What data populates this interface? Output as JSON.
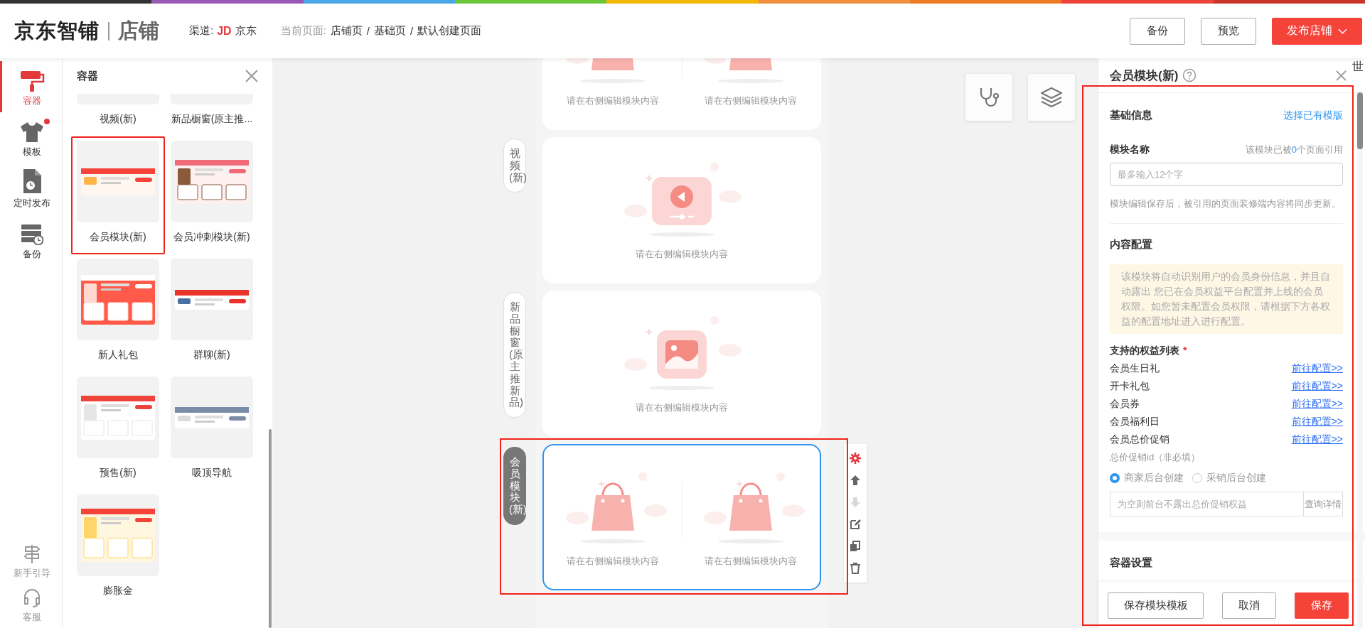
{
  "header": {
    "logo": "京东智铺",
    "section": "店铺",
    "channel_label": "渠道:",
    "channel_badge": "JD",
    "channel_name": "京东",
    "breadcrumb_label": "当前页面:",
    "breadcrumb": [
      {
        "kind": "page",
        "text": "店铺页"
      },
      {
        "kind": "separator",
        "text": "/"
      },
      {
        "kind": "page",
        "text": "基础页"
      },
      {
        "kind": "separator",
        "text": "/"
      },
      {
        "kind": "page",
        "text": "默认创建页面"
      }
    ],
    "buttons": [
      {
        "label": "备份",
        "kind": "outline"
      },
      {
        "label": "预览",
        "kind": "outline"
      },
      {
        "label": "发布店铺",
        "kind": "primary"
      }
    ]
  },
  "rail": {
    "items": [
      {
        "label": "容器",
        "selected": true,
        "dot": false
      },
      {
        "label": "模板",
        "selected": false,
        "dot": true
      },
      {
        "label": "定时发布",
        "selected": false,
        "dot": false
      },
      {
        "label": "备份",
        "selected": false,
        "dot": false
      }
    ],
    "bottom_items": [
      {
        "label": "新手引导"
      },
      {
        "label": "客服"
      }
    ]
  },
  "container_panel": {
    "title": "容器",
    "items": [
      {
        "label": "视频(新)",
        "kind": "partial"
      },
      {
        "label": "新品橱窗(原主推...",
        "kind": "partial"
      },
      {
        "label": "会员模块(新)",
        "kind": "picture",
        "highlighted": true
      },
      {
        "label": "会员冲刺模块(新)",
        "kind": "picture",
        "highlighted": false
      },
      {
        "label": "新人礼包",
        "kind": "picture",
        "highlighted": false
      },
      {
        "label": "群聊(新)",
        "kind": "picture",
        "highlighted": false
      },
      {
        "label": "预售(新)",
        "kind": "picture",
        "highlighted": false
      },
      {
        "label": "吸顶导航",
        "kind": "picture",
        "highlighted": false
      },
      {
        "label": "膨胀金",
        "kind": "picture",
        "highlighted": false
      }
    ]
  },
  "canvas": {
    "modules": [
      {
        "kind": "partial",
        "selected": false,
        "slots": [
          {
            "kind": "bag",
            "text": "请在右侧编辑模块内容"
          },
          {
            "kind": "bag",
            "text": "请在右侧编辑模块内容"
          }
        ]
      },
      {
        "kind": "full",
        "label": "视频(新)",
        "selected": false,
        "slots": [
          {
            "kind": "video",
            "text": "请在右侧编辑模块内容"
          }
        ]
      },
      {
        "kind": "full",
        "label": "新品橱窗(原主推新品)",
        "selected": false,
        "slots": [
          {
            "text": "请在右侧编辑模块内容"
          }
        ]
      },
      {
        "kind": "full",
        "label": "会员模块(新)",
        "selected": true,
        "slots": [
          {
            "kind": "bag",
            "text": "请在右侧编辑模块内容"
          },
          {
            "kind": "bag",
            "text": "请在右侧编辑模块内容"
          }
        ]
      }
    ],
    "toolbar": [
      {
        "active": true,
        "disabled": false
      },
      {
        "active": false,
        "disabled": false
      },
      {
        "active": false,
        "disabled": true
      },
      {
        "active": false,
        "disabled": false
      },
      {
        "active": false,
        "disabled": false
      },
      {
        "active": false,
        "disabled": false
      }
    ]
  },
  "editor": {
    "title": "会员模块(新)",
    "edge_text": "世",
    "highlighted": true,
    "basic_heading": "基础信息",
    "basic_link": "选择已有模版",
    "name_label": "模块名称",
    "usage_prefix": "该模块已被",
    "usage_count": "0",
    "usage_suffix": "个页面引用",
    "name_placeholder": "最多输入12个字",
    "name_hint": "模块编辑保存后，被引用的页面装修端内容将同步更新。",
    "content_heading": "内容配置",
    "notice": "该模块将自动识别用户的会员身份信息，并且自动露出 您已在会员权益平台配置并上线的会员权限。如您暂未配置会员权限，请根据下方各权益的配置地址进入进行配置。",
    "list_label": "支持的权益列表",
    "required": true,
    "required_mark": "*",
    "benefits": [
      {
        "name": "会员生日礼",
        "link": "前往配置>>"
      },
      {
        "name": "开卡礼包",
        "link": "前往配置>>"
      },
      {
        "name": "会员券",
        "link": "前往配置>>"
      },
      {
        "name": "会员福利日",
        "link": "前往配置>>"
      },
      {
        "name": "会员总价促销",
        "link": "前往配置>>"
      }
    ],
    "promo_label": "总价促销id（非必填）",
    "radios": [
      {
        "label": "商家后台创建",
        "selected": true
      },
      {
        "label": "采销后台创建",
        "selected": false
      }
    ],
    "promo_placeholder": "为空则前台不露出总价促销权益",
    "promo_button": "查询详情",
    "container_heading": "容器设置",
    "footer": [
      {
        "label": "保存模块模板",
        "kind": "outline"
      },
      {
        "label": "取消",
        "kind": "outline"
      },
      {
        "label": "保存",
        "kind": "primary"
      }
    ]
  }
}
